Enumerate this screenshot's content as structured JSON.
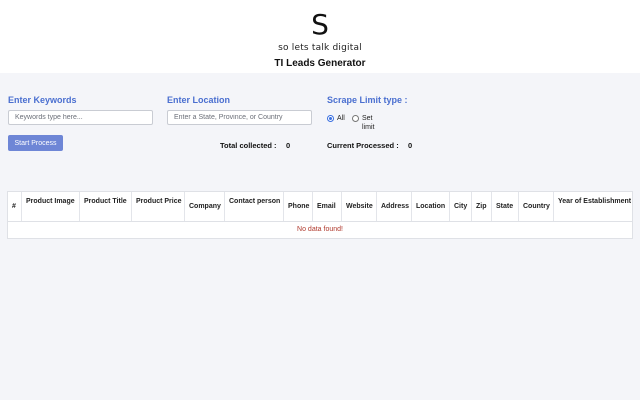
{
  "header": {
    "logo_letter": "S",
    "logo_tagline": "so lets talk digital",
    "title": "TI Leads Generator"
  },
  "form": {
    "keywords": {
      "label": "Enter Keywords",
      "placeholder": "Keywords type here...",
      "value": ""
    },
    "location": {
      "label": "Enter Location",
      "placeholder": "Enter a State, Province, or Country",
      "value": ""
    },
    "scrape_limit": {
      "label": "Scrape Limit type :",
      "options": [
        {
          "label": "All",
          "selected": true
        },
        {
          "label": "Set limit",
          "selected": false
        }
      ]
    },
    "start_button": "Start Process"
  },
  "stats": {
    "total_collected_label": "Total collected :",
    "total_collected_value": "0",
    "current_processed_label": "Current Processed :",
    "current_processed_value": "0"
  },
  "table": {
    "columns": [
      "#",
      "Product Image",
      "Product Title",
      "Product Price",
      "Company",
      "Contact person",
      "Phone",
      "Email",
      "Website",
      "Address",
      "Location",
      "City",
      "Zip",
      "State",
      "Country",
      "Year of Establishment"
    ],
    "rows": [],
    "empty_message": "No data found!"
  },
  "colors": {
    "accent": "#4a6fd0",
    "button": "#6e86d6",
    "radio_selected": "#3a6fe0",
    "empty_message": "#b03a2e",
    "background": "#f4f5f9"
  }
}
